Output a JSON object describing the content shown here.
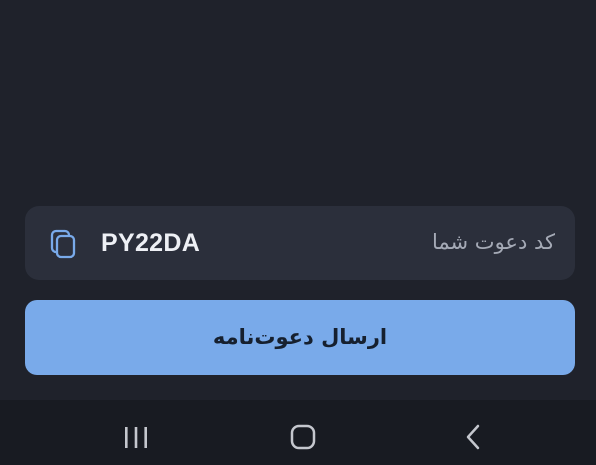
{
  "invite": {
    "label": "کد دعوت شما",
    "code": "PY22DA",
    "copy_icon": "copy-icon"
  },
  "send_button": {
    "label": "ارسال دعوت‌نامه"
  },
  "navbar": {
    "recents_icon": "recents-icon",
    "home_icon": "home-icon",
    "back_icon": "back-icon"
  },
  "colors": {
    "background": "#1f222b",
    "card": "#2b2f3b",
    "accent": "#79aaea",
    "navbar": "#181b22"
  }
}
